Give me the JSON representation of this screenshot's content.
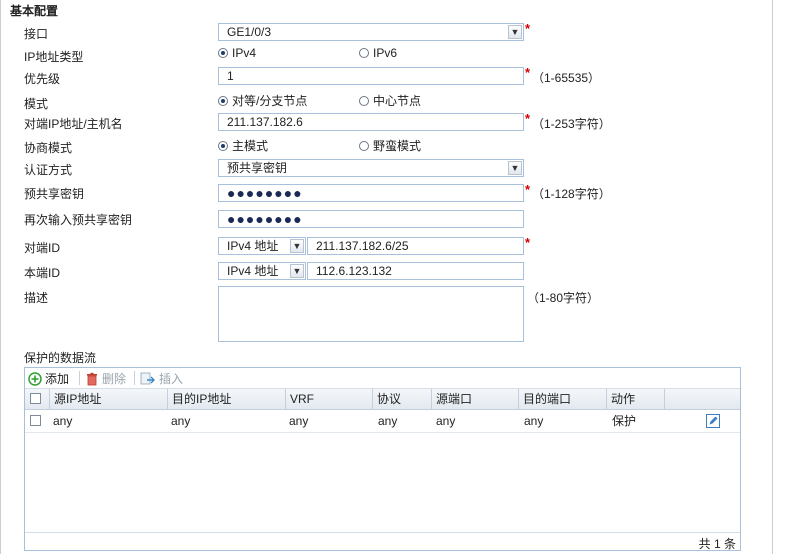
{
  "section_title": "基本配置",
  "fields": {
    "interface": {
      "label": "接口",
      "value": "GE1/0/3"
    },
    "ip_type": {
      "label": "IP地址类型",
      "options": [
        "IPv4",
        "IPv6"
      ],
      "selected": "IPv4"
    },
    "priority": {
      "label": "优先级",
      "value": "1",
      "hint": "（1-65535）"
    },
    "mode": {
      "label": "模式",
      "options": [
        "对等/分支节点",
        "中心节点"
      ],
      "selected": "对等/分支节点"
    },
    "peer_addr": {
      "label": "对端IP地址/主机名",
      "value": "211.137.182.6",
      "hint": "（1-253字符）"
    },
    "negotiation_mode": {
      "label": "协商模式",
      "options": [
        "主模式",
        "野蛮模式"
      ],
      "selected": "主模式"
    },
    "auth_method": {
      "label": "认证方式",
      "value": "预共享密钥"
    },
    "psk": {
      "label": "预共享密钥",
      "value": "●●●●●●●●",
      "hint": "（1-128字符）"
    },
    "psk_confirm": {
      "label": "再次输入预共享密钥",
      "value": "●●●●●●●●"
    },
    "peer_id": {
      "label": "对端ID",
      "type": "IPv4 地址",
      "value": "211.137.182.6/25"
    },
    "local_id": {
      "label": "本端ID",
      "type": "IPv4 地址",
      "value": "112.6.123.132"
    },
    "description": {
      "label": "描述",
      "value": "",
      "hint": "（1-80字符）"
    }
  },
  "flow": {
    "title": "保护的数据流",
    "toolbar": {
      "add": "添加",
      "delete": "删除",
      "insert": "插入"
    },
    "columns": [
      "源IP地址",
      "目的IP地址",
      "VRF",
      "协议",
      "源端口",
      "目的端口",
      "动作"
    ],
    "rows": [
      {
        "src_ip": "any",
        "dst_ip": "any",
        "vrf": "any",
        "protocol": "any",
        "src_port": "any",
        "dst_port": "any",
        "action": "保护"
      }
    ],
    "total": "共 1 条"
  },
  "colors": {
    "border": "#a9c0da",
    "required": "#d40000",
    "add_icon": "#2f9e2f",
    "delete_icon": "#d9483b"
  }
}
